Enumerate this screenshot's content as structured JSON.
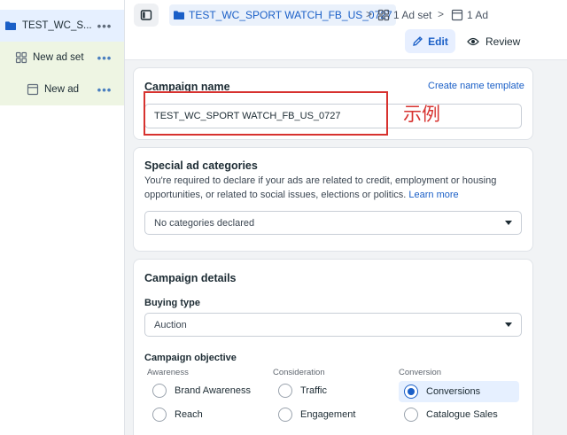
{
  "sidebar": {
    "campaign_label": "TEST_WC_S...",
    "adset_label": "New ad set",
    "ad_label": "New ad",
    "more": "•••"
  },
  "breadcrumb": {
    "campaign": "TEST_WC_SPORT WATCH_FB_US_0727",
    "adset": "1 Ad set",
    "ad": "1 Ad",
    "separator": ">"
  },
  "toolbar": {
    "edit_label": "Edit",
    "review_label": "Review"
  },
  "campaign_name": {
    "title": "Campaign name",
    "template_link": "Create name template",
    "value": "TEST_WC_SPORT WATCH_FB_US_0727",
    "annotation": "示例"
  },
  "special_ad": {
    "title": "Special ad categories",
    "description": "You're required to declare if your ads are related to credit, employment or housing opportunities, or related to social issues, elections or politics.",
    "learn_more": "Learn more",
    "select_value": "No categories declared"
  },
  "campaign_details": {
    "title": "Campaign details",
    "buying_type_label": "Buying type",
    "buying_type_value": "Auction",
    "objective_label": "Campaign objective",
    "columns": {
      "awareness": "Awareness",
      "consideration": "Consideration",
      "conversion": "Conversion"
    },
    "options": {
      "brand_awareness": "Brand Awareness",
      "reach": "Reach",
      "traffic": "Traffic",
      "engagement": "Engagement",
      "conversions": "Conversions",
      "catalogue_sales": "Catalogue Sales"
    },
    "selected": "conversions"
  },
  "colors": {
    "accent": "#1a5fc7",
    "annotation_red": "#d7322f"
  }
}
